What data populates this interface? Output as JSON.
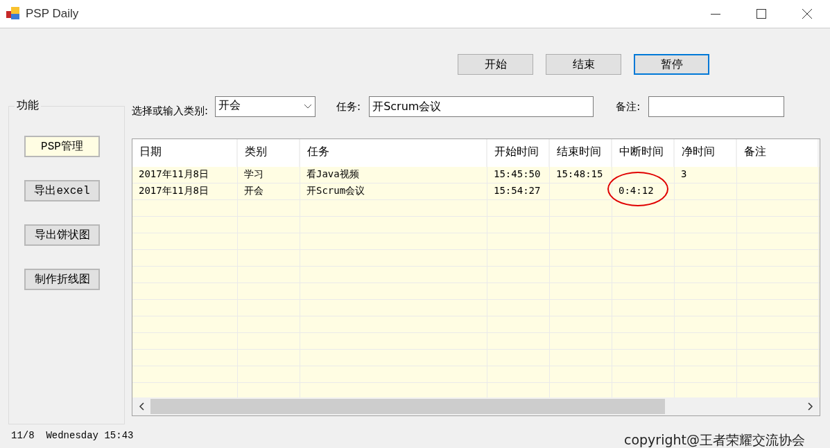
{
  "window": {
    "title": "PSP Daily"
  },
  "top_buttons": [
    {
      "label": "开始",
      "focused": false
    },
    {
      "label": "结束",
      "focused": false
    },
    {
      "label": "暂停",
      "focused": true
    }
  ],
  "function_group": {
    "title": "功能",
    "buttons": [
      {
        "label": "PSP管理",
        "selected": true
      },
      {
        "label": "导出excel",
        "selected": false
      },
      {
        "label": "导出饼状图",
        "selected": false
      },
      {
        "label": "制作折线图",
        "selected": false
      }
    ]
  },
  "filters": {
    "category_label": "选择或输入类别:",
    "category_value": "开会",
    "task_label": "任务:",
    "task_value": "开Scrum会议",
    "note_label": "备注:"
  },
  "table": {
    "columns": [
      "日期",
      "类别",
      "任务",
      "开始时间",
      "结束时间",
      "中断时间",
      "净时间",
      "备注"
    ],
    "rows": [
      [
        "2017年11月8日",
        "学习",
        "看Java视频",
        "15:45:50",
        "15:48:15",
        "",
        "3",
        ""
      ],
      [
        "2017年11月8日",
        "开会",
        "开Scrum会议",
        "15:54:27",
        "",
        "0:4:12",
        "",
        ""
      ]
    ]
  },
  "status_bar": {
    "datetime": "11/8  Wednesday 15:43",
    "copyright": "copyright@王者荣耀交流协会"
  }
}
